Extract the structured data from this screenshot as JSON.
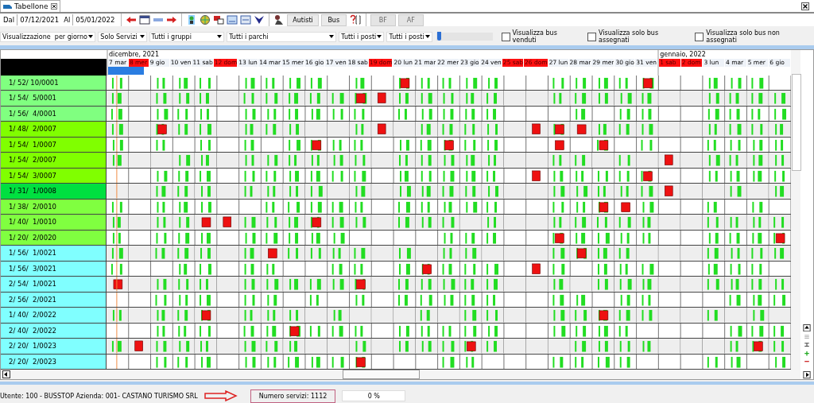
{
  "tab": {
    "title": "Tabellone"
  },
  "toolbar": {
    "from_label": "Dal",
    "from_value": "07/12/2021",
    "to_label": "Al",
    "to_value": "05/01/2022",
    "buttons": [
      {
        "label": "Autisti",
        "disabled": false
      },
      {
        "label": "Bus",
        "disabled": false
      },
      {
        "label": "BF",
        "disabled": true
      },
      {
        "label": "AF",
        "disabled": true
      }
    ]
  },
  "filters": {
    "dropdowns": [
      "Visualizzazione  per giorno",
      "Solo Servizi",
      "Tutti i gruppi",
      "Tutti i parchi",
      "Tutti i posti",
      "Tutti i posti"
    ],
    "zoom_slider": {
      "level": 0.02
    },
    "checkboxes": [
      {
        "label": "Visualizza bus venduti",
        "checked": false
      },
      {
        "label": "Visualizza solo bus assegnati",
        "checked": false
      },
      {
        "label": "Visualizza solo bus non assegnati",
        "checked": false
      }
    ]
  },
  "schedule": {
    "months": [
      {
        "label": "dicembre, 2021",
        "days": [
          {
            "label": "7 mar",
            "holiday": false
          },
          {
            "label": "8 mer",
            "holiday": true
          },
          {
            "label": "9 gio",
            "holiday": false
          },
          {
            "label": "10 ven",
            "holiday": false
          },
          {
            "label": "11 sab",
            "holiday": false
          },
          {
            "label": "12 dom",
            "holiday": true
          },
          {
            "label": "13 lun",
            "holiday": false
          },
          {
            "label": "14 mar",
            "holiday": false
          },
          {
            "label": "15 mer",
            "holiday": false
          },
          {
            "label": "16 gio",
            "holiday": false
          },
          {
            "label": "17 ven",
            "holiday": false
          },
          {
            "label": "18 sab",
            "holiday": false
          },
          {
            "label": "19 dom",
            "holiday": true
          },
          {
            "label": "20 lun",
            "holiday": false
          },
          {
            "label": "21 mar",
            "holiday": false
          },
          {
            "label": "22 mer",
            "holiday": false
          },
          {
            "label": "23 gio",
            "holiday": false
          },
          {
            "label": "24 ven",
            "holiday": false
          },
          {
            "label": "25 sab",
            "holiday": true
          },
          {
            "label": "26 dom",
            "holiday": true
          },
          {
            "label": "27 lun",
            "holiday": false
          },
          {
            "label": "28 mar",
            "holiday": false
          },
          {
            "label": "29 mer",
            "holiday": false
          },
          {
            "label": "30 gio",
            "holiday": false
          },
          {
            "label": "31 ven",
            "holiday": false
          }
        ]
      },
      {
        "label": "gennaio, 2022",
        "days": [
          {
            "label": "1 sab",
            "holiday": true
          },
          {
            "label": "2 dom",
            "holiday": true
          },
          {
            "label": "3 lun",
            "holiday": false
          },
          {
            "label": "4 mar",
            "holiday": false
          },
          {
            "label": "5 mer",
            "holiday": false
          },
          {
            "label": "6 gio",
            "holiday": false
          }
        ]
      }
    ],
    "rows": [
      {
        "label": "1/ 52/ 10/0001",
        "color": "#80ff80"
      },
      {
        "label": "1/ 54/  5/0001",
        "color": "#80ff80"
      },
      {
        "label": "1/ 56/  4/0001",
        "color": "#80ff80"
      },
      {
        "label": "1/ 48/  2/0007",
        "color": "#80ff00"
      },
      {
        "label": "1/ 54/  1/0007",
        "color": "#80ff00"
      },
      {
        "label": "1/ 54/  2/0007",
        "color": "#80ff00"
      },
      {
        "label": "1/ 54/  3/0007",
        "color": "#80ff00"
      },
      {
        "label": "1/ 31/  1/0008",
        "color": "#00e040"
      },
      {
        "label": "1/ 38/  2/0010",
        "color": "#80ff40"
      },
      {
        "label": "1/ 40/  1/0010",
        "color": "#80ff40"
      },
      {
        "label": "1/ 20/  2/0020",
        "color": "#80ff40"
      },
      {
        "label": "1/ 56/  1/0021",
        "color": "#80ffff"
      },
      {
        "label": "1/ 56/  3/0021",
        "color": "#80ffff"
      },
      {
        "label": "2/ 54/  1/0021",
        "color": "#80ffff"
      },
      {
        "label": "2/ 56/  2/0021",
        "color": "#80ffff"
      },
      {
        "label": "1/ 40/  2/0022",
        "color": "#80ffff"
      },
      {
        "label": "2/ 40/  2/0022",
        "color": "#80ffff"
      },
      {
        "label": "2/ 20/  1/0023",
        "color": "#80ffff"
      },
      {
        "label": "2/ 20/  2/0023",
        "color": "#80ffff"
      }
    ]
  },
  "status_bar": {
    "user": "Utente: 100 - BUSSTOP Azienda: 001- CASTANO TURISMO SRL",
    "services": "Numero servizi: 1112",
    "progress": {
      "label": "0 %",
      "level": 0
    }
  }
}
